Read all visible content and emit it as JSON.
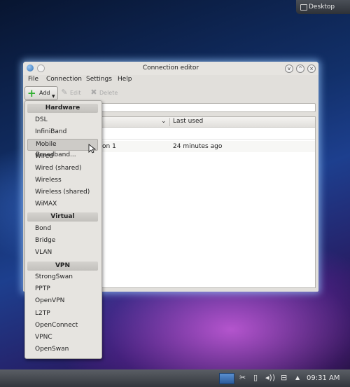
{
  "desktop": {
    "label": "Desktop"
  },
  "window": {
    "title": "Connection editor",
    "close_symbol": "×",
    "maximize_symbol": "^",
    "minimize_symbol": "v"
  },
  "menubar": [
    {
      "label": "File"
    },
    {
      "label": "Connection"
    },
    {
      "label": "Settings"
    },
    {
      "label": "Help"
    }
  ],
  "toolbar": {
    "add_label": "Add",
    "edit_label": "Edit",
    "delete_label": "Delete"
  },
  "search": {
    "value": ""
  },
  "table": {
    "col_used": "Last used",
    "rows": [
      {
        "name": "on 1",
        "used": "24 minutes ago"
      }
    ]
  },
  "dropdown": {
    "hardware_header": "Hardware",
    "hardware": [
      "DSL",
      "InfiniBand",
      "Mobile Broadband...",
      "Wired",
      "Wired (shared)",
      "Wireless",
      "Wireless (shared)",
      "WiMAX"
    ],
    "virtual_header": "Virtual",
    "virtual": [
      "Bond",
      "Bridge",
      "VLAN"
    ],
    "vpn_header": "VPN",
    "vpn": [
      "StrongSwan",
      "PPTP",
      "OpenVPN",
      "L2TP",
      "OpenConnect",
      "VPNC",
      "OpenSwan"
    ]
  },
  "taskbar": {
    "clock": "09:31 AM"
  }
}
